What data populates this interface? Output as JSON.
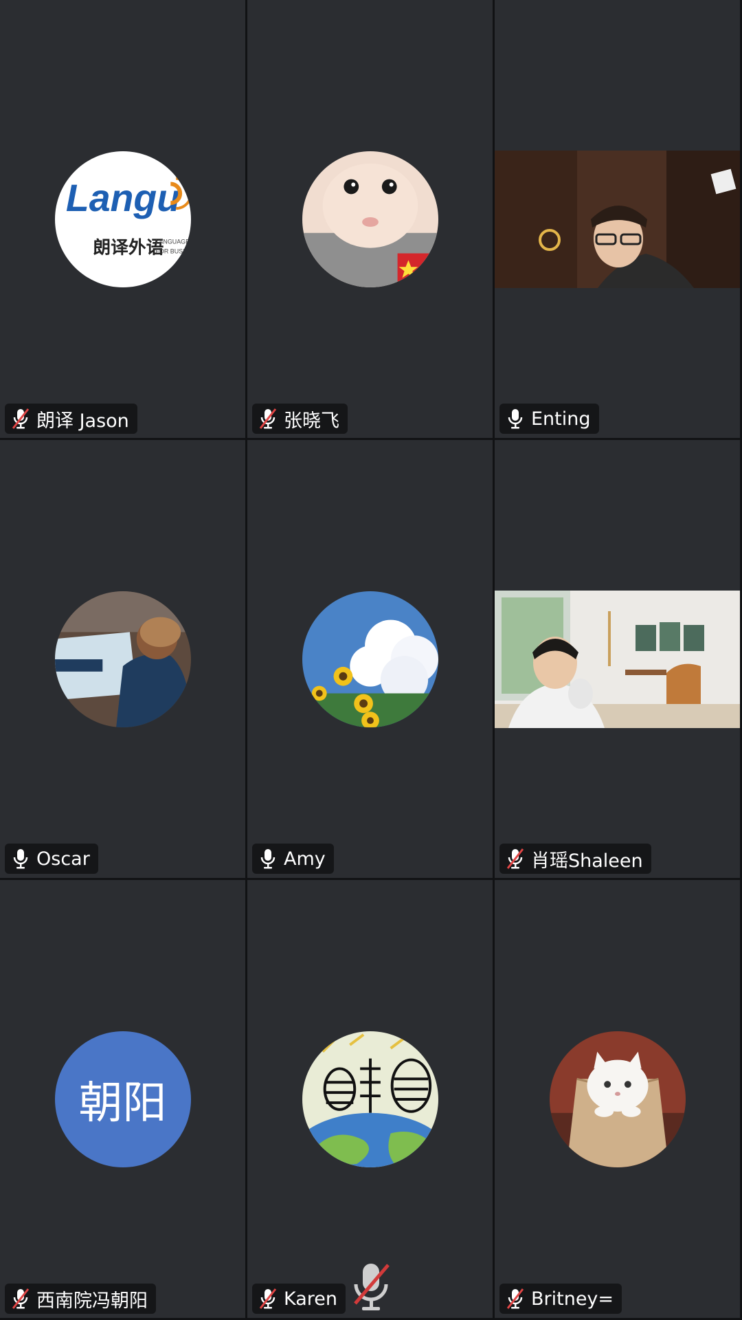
{
  "participants": [
    {
      "name": "朗译 Jason",
      "muted": true,
      "avatar": "languo-logo-avatar"
    },
    {
      "name": "张晓飞",
      "muted": true,
      "avatar": "baby-photo-avatar"
    },
    {
      "name": "Enting",
      "muted": false,
      "avatar": "live-video"
    },
    {
      "name": "Oscar",
      "muted": false,
      "avatar": "child-with-map-avatar"
    },
    {
      "name": "Amy",
      "muted": false,
      "avatar": "sunflowers-clouds-avatar"
    },
    {
      "name": "肖瑶Shaleen",
      "muted": true,
      "avatar": "live-video"
    },
    {
      "name": "西南院冯朝阳",
      "muted": true,
      "avatar": "initials-avatar",
      "initials": "朝阳"
    },
    {
      "name": "Karen",
      "muted": true,
      "avatar": "drawing-globe-avatar"
    },
    {
      "name": "Britney=",
      "muted": true,
      "avatar": "white-cat-avatar"
    }
  ],
  "logo": {
    "brand": "Langu",
    "chinese": "朗译外语",
    "tagline1": "LANGUAGE",
    "tagline2": "FOR BUSINESS"
  },
  "colors": {
    "tile_bg": "#2b2d31",
    "label_bg": "#151618",
    "muted_slash": "#e04545",
    "initials_bg": "#4a76c7"
  },
  "bottom_bar": {
    "icon": "mic-muted-icon"
  }
}
